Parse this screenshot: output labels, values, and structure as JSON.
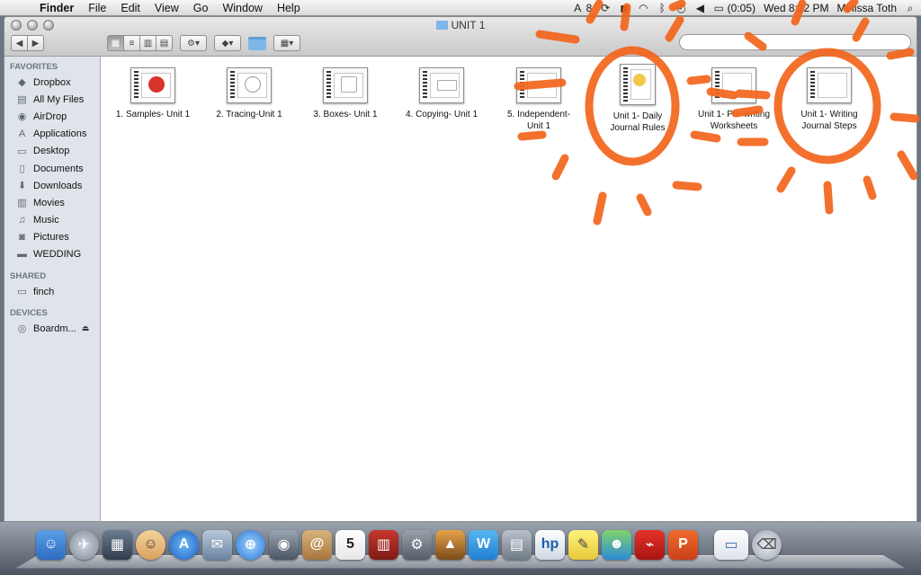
{
  "menubar": {
    "app_name": "Finder",
    "menus": [
      "File",
      "Edit",
      "View",
      "Go",
      "Window",
      "Help"
    ],
    "status": {
      "adobe_count": "8",
      "battery_time": "(0:05)",
      "clock": "Wed 8:22 PM",
      "user": "Melissa Toth"
    }
  },
  "window": {
    "title": "UNIT 1"
  },
  "sidebar": {
    "favorites_label": "FAVORITES",
    "favorites": [
      {
        "label": "Dropbox",
        "icon": "dropbox-icon"
      },
      {
        "label": "All My Files",
        "icon": "all-files-icon"
      },
      {
        "label": "AirDrop",
        "icon": "airdrop-icon"
      },
      {
        "label": "Applications",
        "icon": "applications-icon"
      },
      {
        "label": "Desktop",
        "icon": "desktop-icon"
      },
      {
        "label": "Documents",
        "icon": "documents-icon"
      },
      {
        "label": "Downloads",
        "icon": "downloads-icon"
      },
      {
        "label": "Movies",
        "icon": "movies-icon"
      },
      {
        "label": "Music",
        "icon": "music-icon"
      },
      {
        "label": "Pictures",
        "icon": "pictures-icon"
      },
      {
        "label": "WEDDING",
        "icon": "folder-icon"
      }
    ],
    "shared_label": "SHARED",
    "shared": [
      {
        "label": "finch",
        "icon": "computer-icon"
      }
    ],
    "devices_label": "DEVICES",
    "devices": [
      {
        "label": "Boardm...",
        "icon": "disk-icon"
      }
    ]
  },
  "files": [
    {
      "name_line1": "1.  Samples- Unit 1",
      "name_line2": ""
    },
    {
      "name_line1": "2.  Tracing-Unit 1",
      "name_line2": ""
    },
    {
      "name_line1": "3.  Boxes- Unit 1",
      "name_line2": ""
    },
    {
      "name_line1": "4.  Copying- Unit 1",
      "name_line2": ""
    },
    {
      "name_line1": "5.  Independent-",
      "name_line2": "Unit 1"
    },
    {
      "name_line1": "Unit 1- Daily",
      "name_line2": "Journal Rules"
    },
    {
      "name_line1": "Unit 1- Pre-writing",
      "name_line2": "Worksheets"
    },
    {
      "name_line1": "Unit 1- Writing",
      "name_line2": "Journal Steps"
    }
  ],
  "colors": {
    "annotation": "#f3651c",
    "sidebar_bg": "#dfe4ea",
    "folder_blue": "#7fb6e8"
  }
}
